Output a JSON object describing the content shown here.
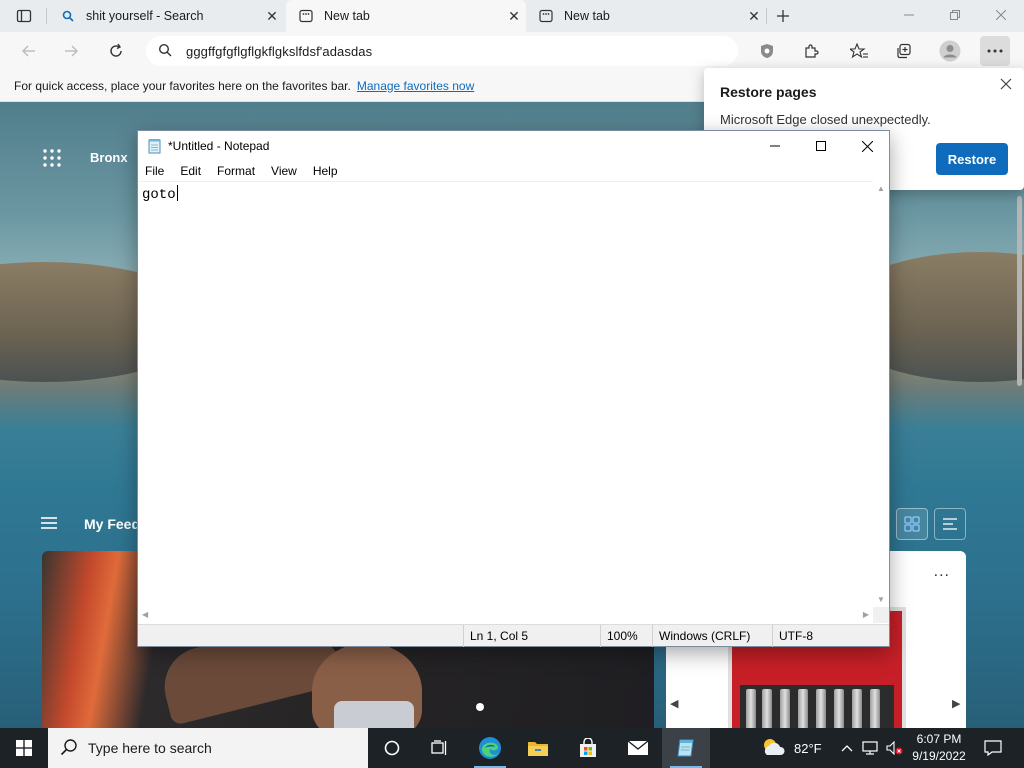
{
  "browser": {
    "tabs": [
      {
        "title": "shit yourself - Search",
        "favicon": "search-icon",
        "active": false
      },
      {
        "title": "New tab",
        "favicon": "newtab-icon",
        "active": true
      },
      {
        "title": "New tab",
        "favicon": "newtab-icon",
        "active": false
      }
    ],
    "address": "gggffgfgflgflgkflgkslfdsf'adasdas",
    "favorites_bar": {
      "message": "For quick access, place your favorites here on the favorites bar.",
      "link": "Manage favorites now"
    }
  },
  "restore_popup": {
    "title": "Restore pages",
    "message": "Microsoft Edge closed unexpectedly.",
    "button": "Restore"
  },
  "new_tab_page": {
    "location": "Bronx",
    "feed_title": "My Feed",
    "card_more": "..."
  },
  "notepad": {
    "title": "*Untitled - Notepad",
    "menu": [
      "File",
      "Edit",
      "Format",
      "View",
      "Help"
    ],
    "content": "goto",
    "status": {
      "position": "Ln 1, Col 5",
      "zoom": "100%",
      "line_ending": "Windows (CRLF)",
      "encoding": "UTF-8"
    }
  },
  "taskbar": {
    "search_placeholder": "Type here to search",
    "weather_temp": "82°F",
    "time": "6:07 PM",
    "date": "9/19/2022"
  },
  "colors": {
    "accent": "#0f6cbd",
    "taskbar": "#1d2226"
  }
}
